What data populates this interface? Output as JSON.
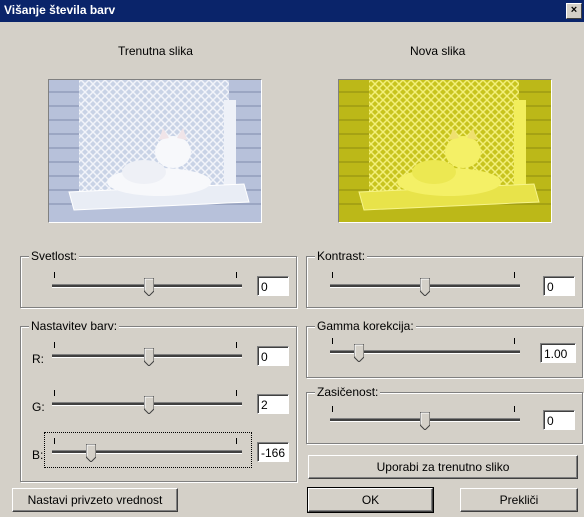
{
  "window": {
    "title": "Višanje števila barv",
    "close_label": "×"
  },
  "previews": {
    "current_label": "Trenutna slika",
    "new_label": "Nova slika"
  },
  "brightness": {
    "label": "Svetlost:",
    "value": "0"
  },
  "color_adjust": {
    "label": "Nastavitev barv:",
    "r_label": "R:",
    "r_value": "0",
    "g_label": "G:",
    "g_value": "2",
    "b_label": "B:",
    "b_value": "-166"
  },
  "contrast": {
    "label": "Kontrast:",
    "value": "0"
  },
  "gamma": {
    "label": "Gamma korekcija:",
    "value": "1.00"
  },
  "saturation": {
    "label": "Zasičenost:",
    "value": "0"
  },
  "buttons": {
    "apply_current": "Uporabi za trenutno sliko",
    "reset": "Nastavi privzeto vrednost",
    "ok": "OK",
    "cancel": "Prekliči"
  },
  "colors": {
    "title_bar": "#0a246a",
    "dialog_bg": "#d4d0c8",
    "tint_new": "#e8e830"
  }
}
